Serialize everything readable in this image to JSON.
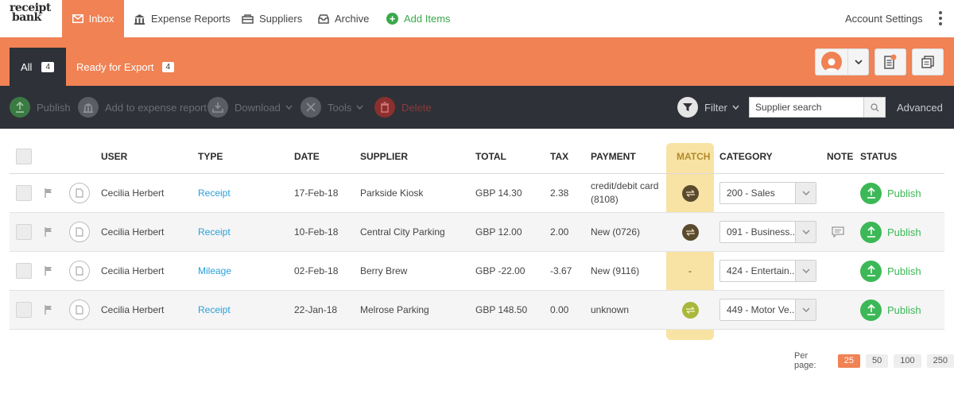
{
  "logo": {
    "line1": "receipt",
    "line2": "bank"
  },
  "nav": {
    "inbox": "Inbox",
    "expense_reports": "Expense Reports",
    "suppliers": "Suppliers",
    "archive": "Archive",
    "add_items": "Add Items",
    "account_settings": "Account Settings"
  },
  "tabs": {
    "all": {
      "label": "All",
      "count": "4"
    },
    "ready": {
      "label": "Ready for Export",
      "count": "4"
    }
  },
  "toolbar": {
    "publish": "Publish",
    "add_to_expense": "Add to expense report",
    "download": "Download",
    "tools": "Tools",
    "delete": "Delete",
    "filter": "Filter",
    "search_placeholder": "Supplier search",
    "advanced": "Advanced"
  },
  "columns": {
    "user": "USER",
    "type": "TYPE",
    "date": "DATE",
    "supplier": "SUPPLIER",
    "total": "TOTAL",
    "tax": "TAX",
    "payment": "PAYMENT",
    "match": "MATCH",
    "category": "CATEGORY",
    "note": "NOTE",
    "status": "STATUS"
  },
  "rows": [
    {
      "user": "Cecilia Herbert",
      "type": "Receipt",
      "date": "17-Feb-18",
      "supplier": "Parkside Kiosk",
      "total": "GBP 14.30",
      "tax": "2.38",
      "payment": "credit/debit card (8108)",
      "match": "matched",
      "category": "200 - Sales",
      "note": false,
      "status": "Publish"
    },
    {
      "user": "Cecilia Herbert",
      "type": "Receipt",
      "date": "10-Feb-18",
      "supplier": "Central City Parking",
      "total": "GBP 12.00",
      "tax": "2.00",
      "payment": "New (0726)",
      "match": "matched",
      "category": "091 - Business...",
      "note": true,
      "status": "Publish"
    },
    {
      "user": "Cecilia Herbert",
      "type": "Mileage",
      "date": "02-Feb-18",
      "supplier": "Berry Brew",
      "total": "GBP -22.00",
      "tax": "-3.67",
      "payment": "New (9116)",
      "match": "-",
      "category": "424 - Entertain...",
      "note": false,
      "status": "Publish"
    },
    {
      "user": "Cecilia Herbert",
      "type": "Receipt",
      "date": "22-Jan-18",
      "supplier": "Melrose Parking",
      "total": "GBP 148.50",
      "tax": "0.00",
      "payment": "unknown",
      "match": "suggested",
      "category": "449 - Motor Ve...",
      "note": false,
      "status": "Publish"
    }
  ],
  "pagination": {
    "label": "Per page:",
    "options": [
      "25",
      "50",
      "100",
      "250"
    ],
    "active": "25"
  },
  "colors": {
    "accent": "#f08254",
    "dark": "#2e3138",
    "publish_green": "#3cb857",
    "link_blue": "#2a9fd8",
    "match_highlight": "#f9e3a4"
  }
}
